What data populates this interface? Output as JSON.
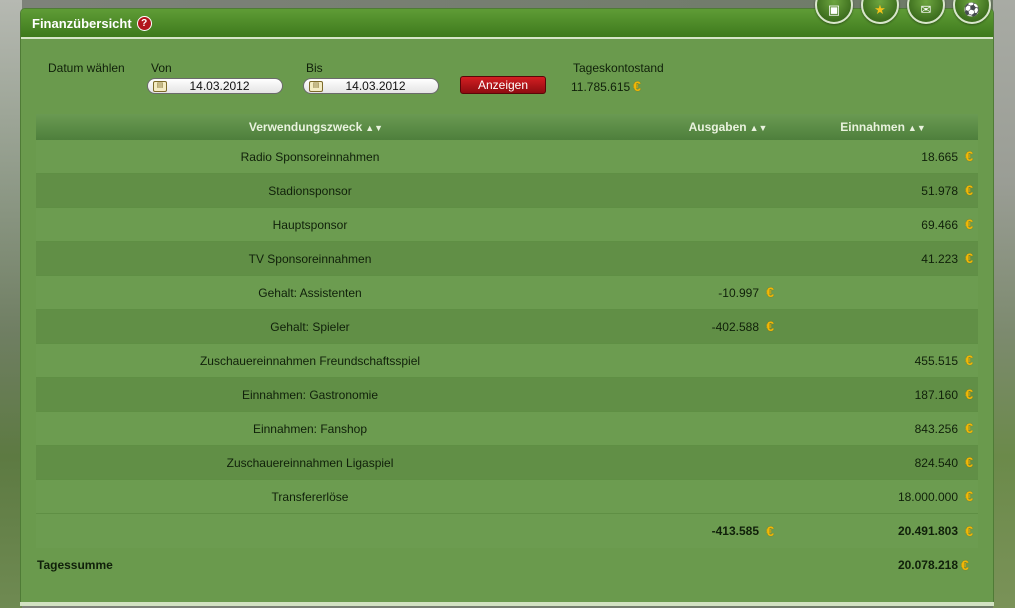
{
  "panel": {
    "title": "Finanzübersicht",
    "help_icon": "?"
  },
  "top_icons": [
    "gift-icon",
    "star-icon",
    "envelope-icon",
    "football-icon"
  ],
  "filter": {
    "label": "Datum wählen",
    "from_label": "Von",
    "from_value": "14.03.2012",
    "to_label": "Bis",
    "to_value": "14.03.2012",
    "show_button": "Anzeigen",
    "balance_label": "Tageskontostand",
    "balance_value": "11.785.615"
  },
  "table": {
    "headers": {
      "purpose": "Verwendungszweck",
      "expenses": "Ausgaben",
      "income": "Einnahmen"
    },
    "rows": [
      {
        "purpose": "Radio Sponsoreinnahmen",
        "expenses": "",
        "income": "18.665"
      },
      {
        "purpose": "Stadionsponsor",
        "expenses": "",
        "income": "51.978"
      },
      {
        "purpose": "Hauptsponsor",
        "expenses": "",
        "income": "69.466"
      },
      {
        "purpose": "TV Sponsoreinnahmen",
        "expenses": "",
        "income": "41.223"
      },
      {
        "purpose": "Gehalt: Assistenten",
        "expenses": "-10.997",
        "income": ""
      },
      {
        "purpose": "Gehalt: Spieler",
        "expenses": "-402.588",
        "income": ""
      },
      {
        "purpose": "Zuschauereinnahmen Freundschaftsspiel",
        "expenses": "",
        "income": "455.515"
      },
      {
        "purpose": "Einnahmen: Gastronomie",
        "expenses": "",
        "income": "187.160"
      },
      {
        "purpose": "Einnahmen: Fanshop",
        "expenses": "",
        "income": "843.256"
      },
      {
        "purpose": "Zuschauereinnahmen Ligaspiel",
        "expenses": "",
        "income": "824.540"
      },
      {
        "purpose": "Transfererlöse",
        "expenses": "",
        "income": "18.000.000"
      }
    ],
    "totals": {
      "expenses": "-413.585",
      "income": "20.491.803"
    }
  },
  "daysum": {
    "label": "Tagessumme",
    "value": "20.078.218"
  },
  "currency_symbol": "€"
}
